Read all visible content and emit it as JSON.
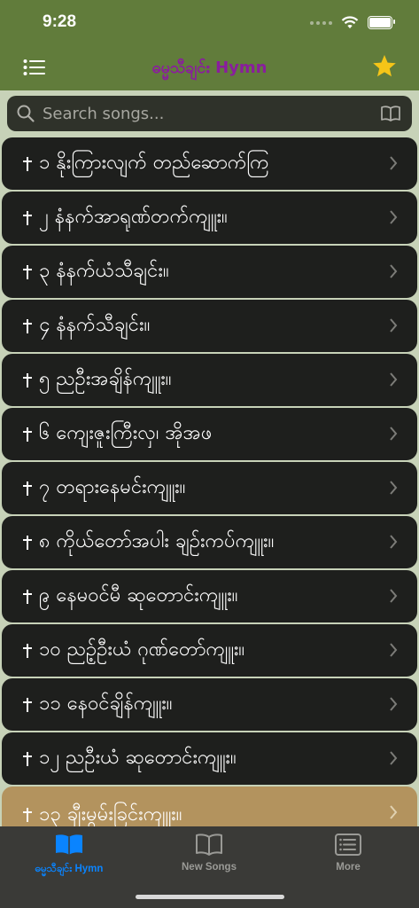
{
  "status": {
    "time": "9:28"
  },
  "header": {
    "title": "ဓမ္မသီချင်း Hymn",
    "star_color": "#f5c518",
    "title_color": "#8a1d9e"
  },
  "search": {
    "placeholder": "Search songs..."
  },
  "songs": [
    {
      "label": "၁ နိုးကြားလျက် တည်ဆောက်ကြ"
    },
    {
      "label": "၂ နံနက်အာရုဏ်တက်ကျူး။"
    },
    {
      "label": "၃ နံနက်ယံသီချင်း။"
    },
    {
      "label": "၄ နံနက်သီချင်း။"
    },
    {
      "label": "၅ ညဦးအချိန်ကျူး။"
    },
    {
      "label": "၆ ကျေးဇူးကြီးလှ၊ အိုအဖ"
    },
    {
      "label": "၇ တရားနေမင်းကျူး။"
    },
    {
      "label": "၈ ကိုယ်တော်အပါး ချဉ်းကပ်ကျူး။"
    },
    {
      "label": "၉ နေမဝင်မီ ဆုတောင်းကျူး။"
    },
    {
      "label": "၁၀ ညဉ့်ဦးယံ ဂုဏ်တော်ကျူး။"
    },
    {
      "label": "၁၁ နေဝင်ချိန်ကျူး။"
    },
    {
      "label": "၁၂ ညဦးယံ ဆုတောင်းကျူး။"
    },
    {
      "label": "၁၃ ချီးမွမ်းခြင်းကျူး။"
    }
  ],
  "tabs": [
    {
      "label": "ဓမ္မသီချင်း Hymn",
      "icon": "open-book-icon",
      "active": true
    },
    {
      "label": "New Songs",
      "icon": "book-outline-icon",
      "active": false
    },
    {
      "label": "More",
      "icon": "list-box-icon",
      "active": false
    }
  ],
  "colors": {
    "accent": "#0a84ff",
    "inactive": "#8e8e93",
    "header_bg": "#617c3b"
  }
}
